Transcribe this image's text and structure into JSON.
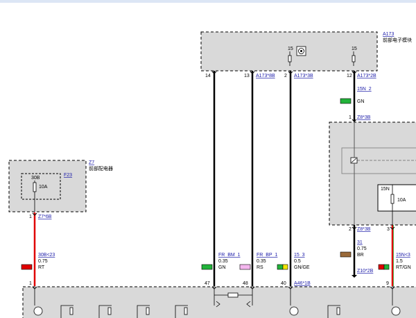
{
  "modules": {
    "a173": {
      "ref": "A173",
      "name": "前部电子模块",
      "pin_a": "15",
      "pin_b": "15"
    },
    "z7": {
      "ref": "Z7",
      "name": "前部配电器",
      "fuse_ref": "F23",
      "fuse_id": "30B",
      "fuse_rating": "10A"
    },
    "z8": {
      "pin_label": "15N",
      "fuse_rating": "10A"
    }
  },
  "pins": {
    "a173_14": "14",
    "a173_13": "13",
    "a173_2": "2",
    "a173_12": "12",
    "z7_1": "1",
    "z8_1": "1",
    "z8_2": "2",
    "z8_3": "3",
    "bot_1": "1",
    "bot_47": "47",
    "bot_48": "48",
    "bot_40": "40",
    "bot_9": "9"
  },
  "connectors": {
    "a173_8b": "A173*8B",
    "a173_3b": "A173*3B",
    "a173_2b": "A173*2B",
    "z7_6b": "Z7*6B",
    "z8_3b_top": "Z8*3B",
    "z8_3b_bot": "Z8*3B",
    "a46_1b": "A46*1B",
    "z10_2b": "Z10*2B"
  },
  "wires": [
    {
      "signal": "30B<23",
      "gauge": "0.75",
      "color_code": "RT",
      "swatch": [
        "#e00000"
      ]
    },
    {
      "signal": "FR_BM_1",
      "gauge": "0.35",
      "color_code": "GN",
      "swatch": [
        "#22b33a"
      ]
    },
    {
      "signal": "FR_BP_1",
      "gauge": "0.35",
      "color_code": "RS",
      "swatch": [
        "#f4b6ee"
      ]
    },
    {
      "signal": "15_3",
      "gauge": "0.5",
      "color_code": "GN/GE",
      "swatch": [
        "#22b33a",
        "#f2e600"
      ]
    },
    {
      "signal": "15N_2",
      "gauge": "",
      "color_code": "GN",
      "swatch": [
        "#22b33a"
      ]
    },
    {
      "signal": "31",
      "gauge": "0.75",
      "color_code": "BR",
      "swatch": [
        "#9a6a3a"
      ]
    },
    {
      "signal": "15N<3",
      "gauge": "1.5",
      "color_code": "RT/GN",
      "swatch": [
        "#e00000",
        "#22b33a"
      ]
    }
  ]
}
